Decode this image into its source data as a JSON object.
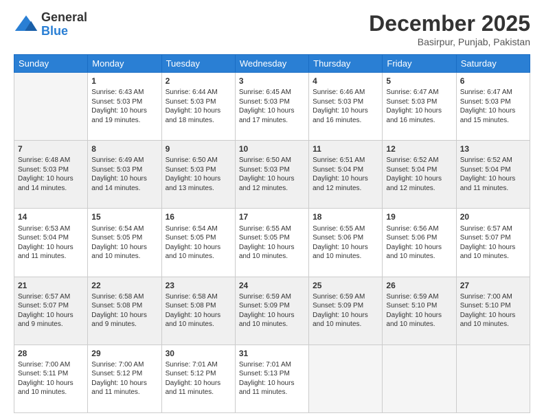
{
  "logo": {
    "general": "General",
    "blue": "Blue"
  },
  "header": {
    "month": "December 2025",
    "location": "Basirpur, Punjab, Pakistan"
  },
  "weekdays": [
    "Sunday",
    "Monday",
    "Tuesday",
    "Wednesday",
    "Thursday",
    "Friday",
    "Saturday"
  ],
  "rows": [
    [
      {
        "day": "",
        "info": ""
      },
      {
        "day": "1",
        "info": "Sunrise: 6:43 AM\nSunset: 5:03 PM\nDaylight: 10 hours\nand 19 minutes."
      },
      {
        "day": "2",
        "info": "Sunrise: 6:44 AM\nSunset: 5:03 PM\nDaylight: 10 hours\nand 18 minutes."
      },
      {
        "day": "3",
        "info": "Sunrise: 6:45 AM\nSunset: 5:03 PM\nDaylight: 10 hours\nand 17 minutes."
      },
      {
        "day": "4",
        "info": "Sunrise: 6:46 AM\nSunset: 5:03 PM\nDaylight: 10 hours\nand 16 minutes."
      },
      {
        "day": "5",
        "info": "Sunrise: 6:47 AM\nSunset: 5:03 PM\nDaylight: 10 hours\nand 16 minutes."
      },
      {
        "day": "6",
        "info": "Sunrise: 6:47 AM\nSunset: 5:03 PM\nDaylight: 10 hours\nand 15 minutes."
      }
    ],
    [
      {
        "day": "7",
        "info": "Sunrise: 6:48 AM\nSunset: 5:03 PM\nDaylight: 10 hours\nand 14 minutes."
      },
      {
        "day": "8",
        "info": "Sunrise: 6:49 AM\nSunset: 5:03 PM\nDaylight: 10 hours\nand 14 minutes."
      },
      {
        "day": "9",
        "info": "Sunrise: 6:50 AM\nSunset: 5:03 PM\nDaylight: 10 hours\nand 13 minutes."
      },
      {
        "day": "10",
        "info": "Sunrise: 6:50 AM\nSunset: 5:03 PM\nDaylight: 10 hours\nand 12 minutes."
      },
      {
        "day": "11",
        "info": "Sunrise: 6:51 AM\nSunset: 5:04 PM\nDaylight: 10 hours\nand 12 minutes."
      },
      {
        "day": "12",
        "info": "Sunrise: 6:52 AM\nSunset: 5:04 PM\nDaylight: 10 hours\nand 12 minutes."
      },
      {
        "day": "13",
        "info": "Sunrise: 6:52 AM\nSunset: 5:04 PM\nDaylight: 10 hours\nand 11 minutes."
      }
    ],
    [
      {
        "day": "14",
        "info": "Sunrise: 6:53 AM\nSunset: 5:04 PM\nDaylight: 10 hours\nand 11 minutes."
      },
      {
        "day": "15",
        "info": "Sunrise: 6:54 AM\nSunset: 5:05 PM\nDaylight: 10 hours\nand 10 minutes."
      },
      {
        "day": "16",
        "info": "Sunrise: 6:54 AM\nSunset: 5:05 PM\nDaylight: 10 hours\nand 10 minutes."
      },
      {
        "day": "17",
        "info": "Sunrise: 6:55 AM\nSunset: 5:05 PM\nDaylight: 10 hours\nand 10 minutes."
      },
      {
        "day": "18",
        "info": "Sunrise: 6:55 AM\nSunset: 5:06 PM\nDaylight: 10 hours\nand 10 minutes."
      },
      {
        "day": "19",
        "info": "Sunrise: 6:56 AM\nSunset: 5:06 PM\nDaylight: 10 hours\nand 10 minutes."
      },
      {
        "day": "20",
        "info": "Sunrise: 6:57 AM\nSunset: 5:07 PM\nDaylight: 10 hours\nand 10 minutes."
      }
    ],
    [
      {
        "day": "21",
        "info": "Sunrise: 6:57 AM\nSunset: 5:07 PM\nDaylight: 10 hours\nand 9 minutes."
      },
      {
        "day": "22",
        "info": "Sunrise: 6:58 AM\nSunset: 5:08 PM\nDaylight: 10 hours\nand 9 minutes."
      },
      {
        "day": "23",
        "info": "Sunrise: 6:58 AM\nSunset: 5:08 PM\nDaylight: 10 hours\nand 10 minutes."
      },
      {
        "day": "24",
        "info": "Sunrise: 6:59 AM\nSunset: 5:09 PM\nDaylight: 10 hours\nand 10 minutes."
      },
      {
        "day": "25",
        "info": "Sunrise: 6:59 AM\nSunset: 5:09 PM\nDaylight: 10 hours\nand 10 minutes."
      },
      {
        "day": "26",
        "info": "Sunrise: 6:59 AM\nSunset: 5:10 PM\nDaylight: 10 hours\nand 10 minutes."
      },
      {
        "day": "27",
        "info": "Sunrise: 7:00 AM\nSunset: 5:10 PM\nDaylight: 10 hours\nand 10 minutes."
      }
    ],
    [
      {
        "day": "28",
        "info": "Sunrise: 7:00 AM\nSunset: 5:11 PM\nDaylight: 10 hours\nand 10 minutes."
      },
      {
        "day": "29",
        "info": "Sunrise: 7:00 AM\nSunset: 5:12 PM\nDaylight: 10 hours\nand 11 minutes."
      },
      {
        "day": "30",
        "info": "Sunrise: 7:01 AM\nSunset: 5:12 PM\nDaylight: 10 hours\nand 11 minutes."
      },
      {
        "day": "31",
        "info": "Sunrise: 7:01 AM\nSunset: 5:13 PM\nDaylight: 10 hours\nand 11 minutes."
      },
      {
        "day": "",
        "info": ""
      },
      {
        "day": "",
        "info": ""
      },
      {
        "day": "",
        "info": ""
      }
    ]
  ],
  "shaded_rows": [
    1,
    3
  ]
}
